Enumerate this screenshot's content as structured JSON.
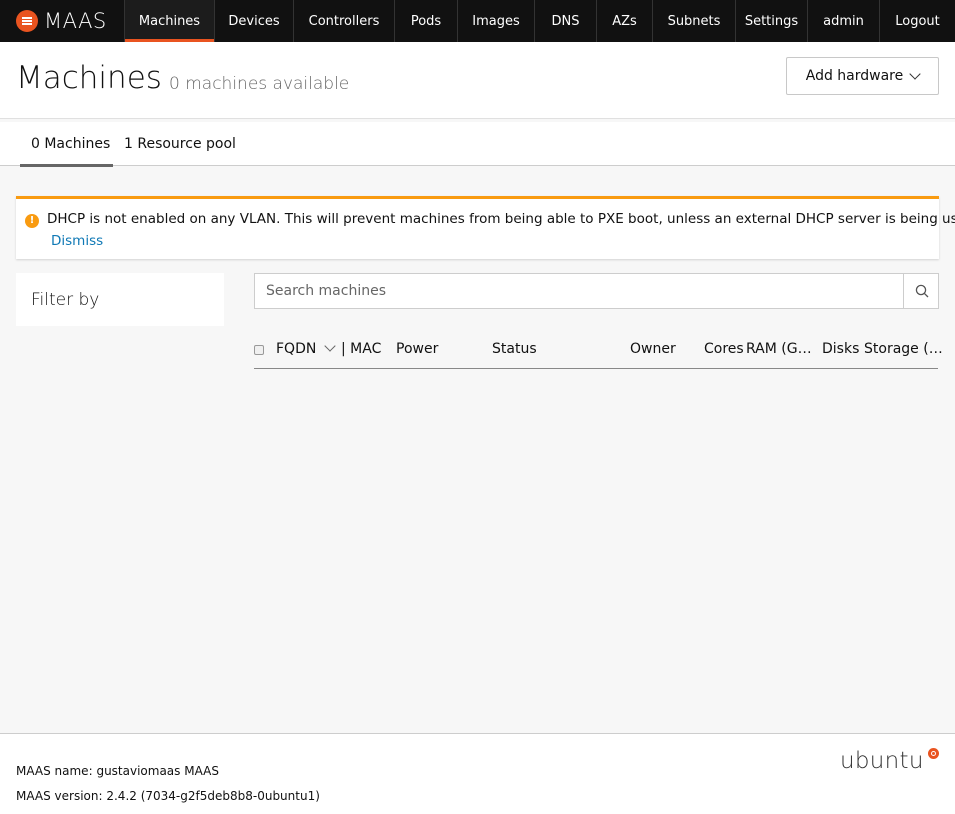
{
  "brand": {
    "name": "MAAS"
  },
  "nav": [
    {
      "label": "Machines",
      "active": true
    },
    {
      "label": "Devices"
    },
    {
      "label": "Controllers"
    },
    {
      "label": "Pods"
    },
    {
      "label": "Images"
    },
    {
      "label": "DNS"
    },
    {
      "label": "AZs"
    },
    {
      "label": "Subnets"
    },
    {
      "label": "Settings"
    },
    {
      "label": "admin"
    },
    {
      "label": "Logout"
    }
  ],
  "header": {
    "title": "Machines",
    "subtitle": "0 machines available",
    "add_hardware_label": "Add hardware"
  },
  "tabs": [
    {
      "label": "0 Machines",
      "active": true
    },
    {
      "label": "1 Resource pool"
    }
  ],
  "notification": {
    "icon": "warning-icon",
    "message": "DHCP is not enabled on any VLAN. This will prevent machines from being able to PXE boot, unless an external DHCP server is being used.",
    "dismiss_label": "Dismiss",
    "accent_color": "#f99b11"
  },
  "filter": {
    "title": "Filter by"
  },
  "search": {
    "placeholder": "Search machines",
    "value": ""
  },
  "table": {
    "columns": [
      "FQDN",
      "| MAC",
      "Power",
      "Status",
      "Owner",
      "Cores",
      "RAM (G…",
      "Disks",
      "Storage (…"
    ],
    "rows": []
  },
  "footer": {
    "name_label": "MAAS name:",
    "name_value": "gustaviomaas MAAS",
    "version_label": "MAAS version:",
    "version_value": "2.4.2 (7034-g2f5deb8b8-0ubuntu1)",
    "vendor_logo_text": "ubuntu"
  },
  "colors": {
    "brand": "#e95420",
    "nav_bg": "#111111",
    "link": "#0e78b5"
  }
}
